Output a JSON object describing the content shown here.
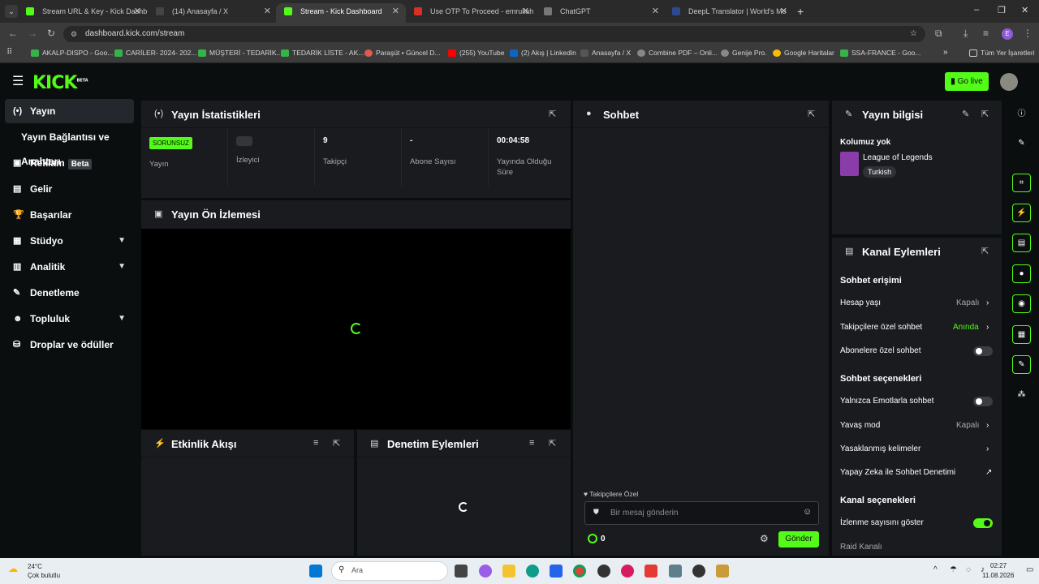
{
  "browser": {
    "tabs": [
      {
        "title": "Stream URL & Key - Kick Dashb",
        "color": "#53fc18",
        "active": false
      },
      {
        "title": "(14) Anasayfa / X",
        "color": "#444444",
        "active": false
      },
      {
        "title": "Stream - Kick Dashboard",
        "color": "#53fc18",
        "active": true
      },
      {
        "title": "Use OTP To Proceed - emrullah",
        "color": "#d93025",
        "active": false
      },
      {
        "title": "ChatGPT",
        "color": "#777777",
        "active": false
      },
      {
        "title": "DeepL Translator | World's Mo",
        "color": "#2c4b8f",
        "active": false
      }
    ],
    "url": "dashboard.kick.com/stream",
    "bookmarks": [
      "AKALP-DISPO - Goo...",
      "CARİLER- 2024- 202...",
      "MÜŞTERİ - TEDARİK...",
      "TEDARİK LİSTE - AK...",
      "Paraşüt • Güncel D...",
      "(255) YouTube",
      "(2) Akış | LinkedIn",
      "Anasayfa / X",
      "Combine PDF – Onli...",
      "Genije Pro.",
      "Google Haritalar",
      "SSA-FRANCE - Goo..."
    ],
    "all_bookmarks": "Tüm Yer İşaretleri"
  },
  "header": {
    "logo": "KICK",
    "logo_sup": "BETA",
    "go_live": "Go live"
  },
  "sidebar": {
    "items": [
      {
        "label": "Yayın",
        "icon": "(•)"
      },
      {
        "label": "Yayın Bağlantısı ve Anahtarı",
        "icon": ""
      },
      {
        "label": "Reklam",
        "icon": "▣",
        "badge": "Beta"
      },
      {
        "label": "Gelir",
        "icon": "▤"
      },
      {
        "label": "Başarılar",
        "icon": "🏆"
      },
      {
        "label": "Stüdyo",
        "icon": "▦"
      },
      {
        "label": "Analitik",
        "icon": "▥"
      },
      {
        "label": "Denetleme",
        "icon": "✎"
      },
      {
        "label": "Topluluk",
        "icon": "☻"
      },
      {
        "label": "Droplar ve ödüller",
        "icon": "⛁"
      }
    ]
  },
  "stats_panel": {
    "title": "Yayın İstatistikleri",
    "status_badge": "SORUNSUZ",
    "status_label": "Yayın",
    "viewers_label": "İzleyici",
    "followers_value": "9",
    "followers_label": "Takipçi",
    "subs_value": "-",
    "subs_label": "Abone Sayısı",
    "uptime_value": "00:04:58",
    "uptime_label": "Yayında Olduğu Süre"
  },
  "preview_panel": {
    "title": "Yayın Ön İzlemesi"
  },
  "activity_panel": {
    "title": "Etkinlik Akışı"
  },
  "mod_panel": {
    "title": "Denetim Eylemleri"
  },
  "chat": {
    "title": "Sohbet",
    "mode_label": "Takipçilere Özel",
    "placeholder": "Bir mesaj gönderin",
    "count": "0",
    "send": "Gönder"
  },
  "stream_info": {
    "title": "Yayın bilgisi",
    "category_line": "Kolumuz yok",
    "game": "League of Legends",
    "language": "Turkish"
  },
  "channel_actions": {
    "title": "Kanal Eylemleri",
    "chat_access": "Sohbet erişimi",
    "account_age": "Hesap yaşı",
    "account_age_val": "Kapalı",
    "followers_only": "Takipçilere özel sohbet",
    "followers_only_val": "Anında",
    "subs_only": "Abonelere özel sohbet",
    "chat_options": "Sohbet seçenekleri",
    "emote_only": "Yalnızca Emotlarla sohbet",
    "slow_mode": "Yavaş mod",
    "slow_mode_val": "Kapalı",
    "banned_words": "Yasaklanmış kelimeler",
    "ai_mod": "Yapay Zeka ile Sohbet Denetimi",
    "channel_options": "Kanal seçenekleri",
    "show_viewers": "İzlenme sayısını göster",
    "raid": "Raid Kanalı"
  },
  "taskbar": {
    "weather_temp": "24°C",
    "weather_desc": "Çok bulutlu",
    "search": "Ara",
    "time": "02:27",
    "date": "11.08.2026"
  }
}
